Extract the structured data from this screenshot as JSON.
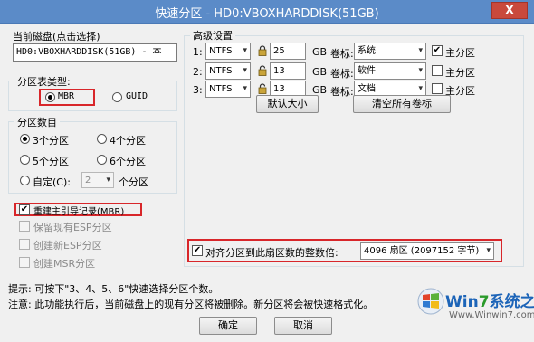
{
  "window": {
    "title": "快速分区 - HD0:VBOXHARDDISK(51GB)",
    "close_label": "X"
  },
  "disk": {
    "group_title": "当前磁盘(点击选择)",
    "value": "HD0:VBOXHARDDISK(51GB) - 本"
  },
  "partition_table": {
    "group_title": "分区表类型:",
    "options": [
      "MBR",
      "GUID"
    ],
    "selected": "MBR"
  },
  "partition_count": {
    "group_title": "分区数目",
    "options": [
      "3个分区",
      "4个分区",
      "5个分区",
      "6个分区"
    ],
    "selected": "3个分区",
    "custom_label": "自定(C):",
    "custom_value": "2",
    "custom_suffix": "个分区"
  },
  "options": {
    "rebuild_mbr": "重建主引导记录(MBR)",
    "keep_esp": "保留现有ESP分区",
    "create_esp": "创建新ESP分区",
    "create_msr": "创建MSR分区"
  },
  "advanced": {
    "group_title": "高级设置",
    "rows": [
      {
        "index": "1:",
        "fs": "NTFS",
        "size": "25",
        "unit": "GB",
        "label_caption": "卷标:",
        "volume": "系统",
        "primary": true,
        "primary_label": "主分区"
      },
      {
        "index": "2:",
        "fs": "NTFS",
        "size": "13",
        "unit": "GB",
        "label_caption": "卷标:",
        "volume": "软件",
        "primary": false,
        "primary_label": "主分区"
      },
      {
        "index": "3:",
        "fs": "NTFS",
        "size": "13",
        "unit": "GB",
        "label_caption": "卷标:",
        "volume": "文档",
        "primary": false,
        "primary_label": "主分区"
      }
    ],
    "default_size_button": "默认大小",
    "clear_labels_button": "清空所有卷标",
    "align_label": "对齐分区到此扇区数的整数倍:",
    "align_value": "4096 扇区 (2097152 字节)"
  },
  "hints": {
    "line1": "提示: 可按下\"3、4、5、6\"快速选择分区个数。",
    "line2": "注意: 此功能执行后，当前磁盘上的现有分区将被删除。新分区将会被快速格式化。"
  },
  "buttons": {
    "ok": "确定",
    "cancel": "取消"
  },
  "watermark": {
    "line1_a": "Win",
    "line1_b": "7",
    "line1_c": "系统之家",
    "line2": "Www.Winwin7.com"
  },
  "colors": {
    "titlebar": "#5b8bc8",
    "highlight_red": "#d8262a"
  }
}
